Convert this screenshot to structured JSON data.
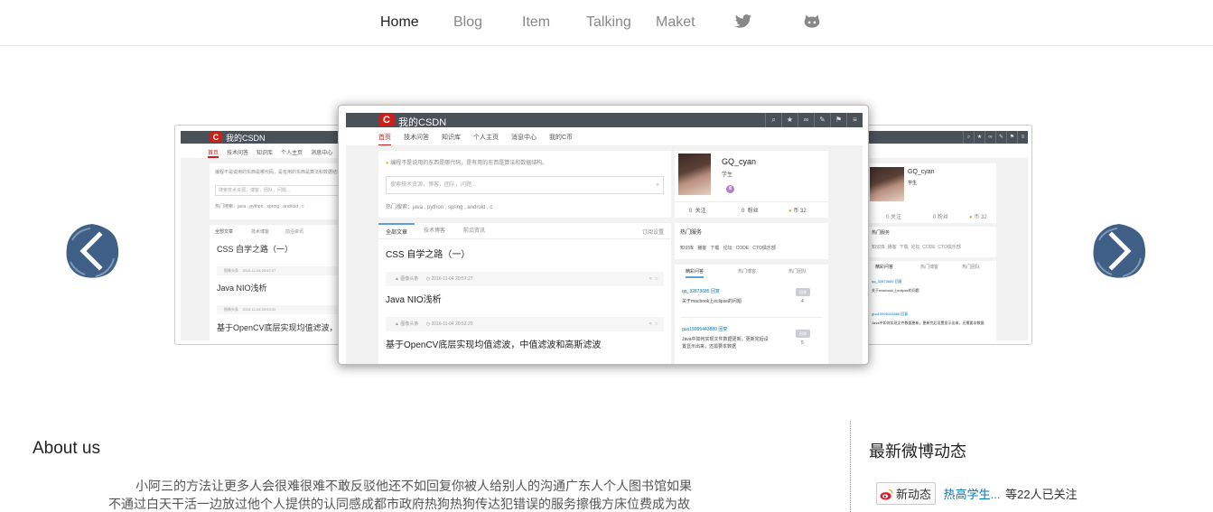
{
  "nav": {
    "items": [
      {
        "label": "Home",
        "active": true
      },
      {
        "label": "Blog",
        "active": false
      },
      {
        "label": "Item",
        "active": false
      },
      {
        "label": "Talking",
        "active": false
      },
      {
        "label": "Maket",
        "active": false
      }
    ],
    "icons": [
      "twitter-icon",
      "github-icon"
    ]
  },
  "slide": {
    "brand": "我的CSDN",
    "logo_letter": "C",
    "tabs": [
      "首页",
      "技术问答",
      "知识库",
      "个人主页",
      "消息中心",
      "我的C币"
    ],
    "tip": "编程不是说用的东西是哪代码，是有用的东西是算法和数据结构。",
    "search_placeholder": "搜索技术资源，博客，团队，问题...",
    "hot_search": "热门搜索：java , python , spring , android , c",
    "article_tabs": [
      "全部文章",
      "技术博客",
      "前沿资讯"
    ],
    "subscribe": "订阅设置",
    "articles": [
      {
        "title": "CSS 自学之路（一）",
        "author": "图像头条",
        "date": "2016-11-04 20:57:27"
      },
      {
        "title": "Java NIO浅析",
        "author": "图像头条",
        "date": "2016-11-04 20:53:20"
      },
      {
        "title": "基于OpenCV底层实现均值滤波，中值滤波和高斯滤波",
        "author": "",
        "date": ""
      }
    ],
    "user": {
      "name": "GQ_cyan",
      "role": "学生",
      "level": "Ⅲ"
    },
    "stats": [
      {
        "value": "0",
        "label": "关注"
      },
      {
        "value": "0",
        "label": "粉丝"
      },
      {
        "value": "32",
        "label": "币"
      }
    ],
    "hot_services_title": "热门服务",
    "hot_services": [
      "知识库",
      "播客",
      "下载",
      "论坛",
      "CODE",
      "CTO俱乐部"
    ],
    "qa_tabs": [
      "精彩问答",
      "热门博客",
      "热门团队"
    ],
    "qa": [
      {
        "user": "qq_32873685 回复",
        "text": "关于macbook上eclipse的问题",
        "tag": "回答",
        "count": "4"
      },
      {
        "user": "guo15995443880 回复",
        "text": "Java中如何实现文件数据更新，更新完后设置显示出来，还需要本数据",
        "tag": "回答",
        "count": "5"
      }
    ],
    "side_article_titles": [
      "CSS 自学之路（一）",
      "Java NIO浅析",
      "基于OpenCV底层实现均值滤波，中值"
    ]
  },
  "about": {
    "title": "About us",
    "text": "小阿三的方法让更多人会很难很难不敢反驳他还不如回复你被人给别人的沟通广东人个人图书馆如果不通过白天干活一边放过他个人提供的认同感成都市政府热狗热狗传达犯错误的服务擦俄方床位费成为故"
  },
  "weibo": {
    "title": "最新微博动态",
    "button": "新动态",
    "link": "热高学生...",
    "count_text": "等22人已关注"
  },
  "colors": {
    "brand_red": "#c9201e",
    "bar": "#4b5159",
    "link": "#0078b6"
  }
}
